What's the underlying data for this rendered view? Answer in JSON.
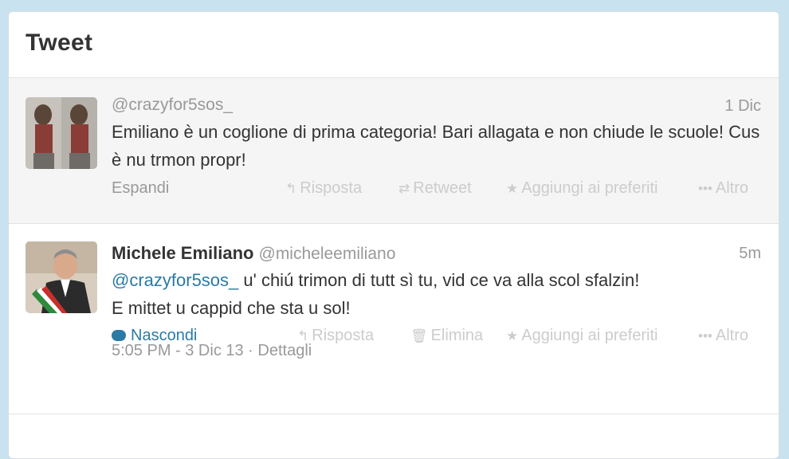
{
  "header": {
    "title": "Tweet"
  },
  "tweets": [
    {
      "handle": "@crazyfor5sos_",
      "time": "1 Dic",
      "text": "Emiliano è un coglione di prima categoria! Bari allagata e non chiude le scuole! Cus è  nu trmon propr!",
      "expand": "Espandi",
      "actions": {
        "reply": "Risposta",
        "retweet": "Retweet",
        "favorite": "Aggiungi ai preferiti",
        "more": "Altro"
      }
    },
    {
      "name": "Michele Emiliano",
      "handle": "@micheleemiliano",
      "time": "5m",
      "mention": "@crazyfor5sos_",
      "text_line1": " u' chiú trimon di tutt sì tu, vid ce va alla scol sfalzin!",
      "text_line2": "E mittet u cappid che sta u sol!",
      "expand": "Nascondi",
      "actions": {
        "reply": "Risposta",
        "delete": "Elimina",
        "favorite": "Aggiungi ai preferiti",
        "more": "Altro"
      },
      "timestamp": "5:05 PM - 3 Dic 13 · Dettagli"
    }
  ],
  "colors": {
    "link": "#2a7aa6",
    "muted": "#999999",
    "background": "#c9e2ef"
  }
}
